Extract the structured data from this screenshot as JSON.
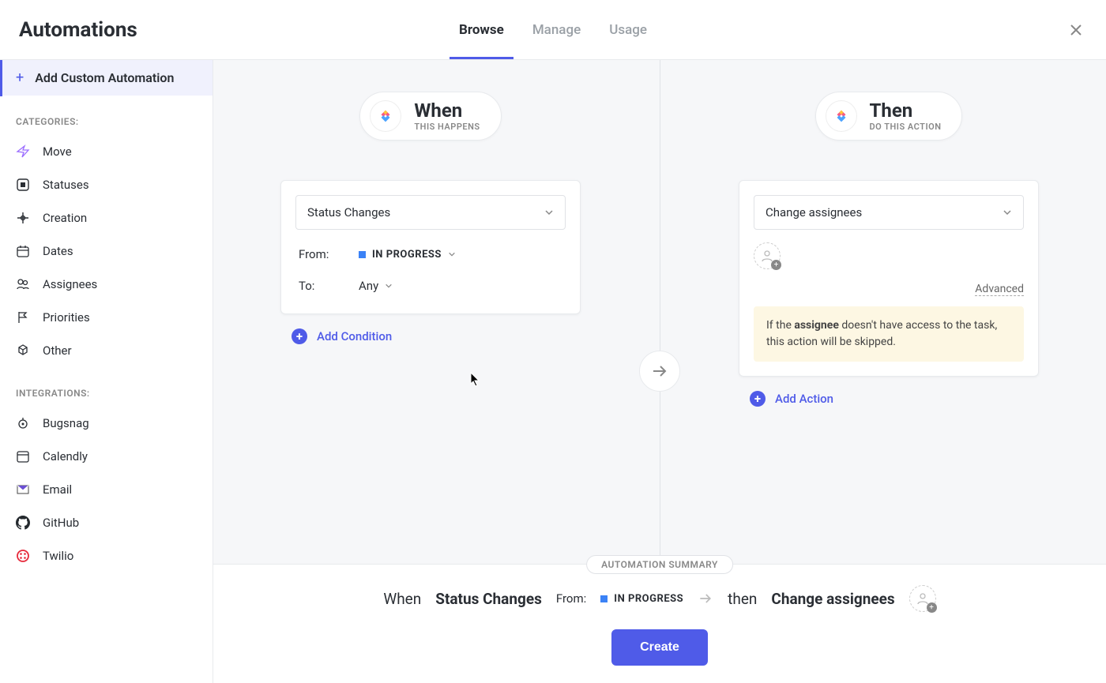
{
  "header": {
    "title": "Automations",
    "tabs": [
      "Browse",
      "Manage",
      "Usage"
    ],
    "active_tab": 0
  },
  "sidebar": {
    "add_button": "Add Custom Automation",
    "categories_label": "CATEGORIES:",
    "categories": [
      {
        "label": "Move",
        "icon": "move-icon"
      },
      {
        "label": "Statuses",
        "icon": "statuses-icon"
      },
      {
        "label": "Creation",
        "icon": "creation-icon"
      },
      {
        "label": "Dates",
        "icon": "dates-icon"
      },
      {
        "label": "Assignees",
        "icon": "assignees-icon"
      },
      {
        "label": "Priorities",
        "icon": "priorities-icon"
      },
      {
        "label": "Other",
        "icon": "other-icon"
      }
    ],
    "integrations_label": "INTEGRATIONS:",
    "integrations": [
      {
        "label": "Bugsnag",
        "icon": "bugsnag-icon"
      },
      {
        "label": "Calendly",
        "icon": "calendly-icon"
      },
      {
        "label": "Email",
        "icon": "email-icon"
      },
      {
        "label": "GitHub",
        "icon": "github-icon"
      },
      {
        "label": "Twilio",
        "icon": "twilio-icon"
      }
    ]
  },
  "when": {
    "title": "When",
    "subtitle": "THIS HAPPENS",
    "trigger": "Status Changes",
    "from_label": "From:",
    "from_value": "IN PROGRESS",
    "to_label": "To:",
    "to_value": "Any",
    "add_condition": "Add Condition"
  },
  "then": {
    "title": "Then",
    "subtitle": "DO THIS ACTION",
    "action": "Change assignees",
    "advanced": "Advanced",
    "notice_pre": "If the ",
    "notice_bold": "assignee",
    "notice_post": " doesn't have access to the task, this action will be skipped.",
    "add_action": "Add Action"
  },
  "summary": {
    "label": "AUTOMATION SUMMARY",
    "when_text": "When",
    "trigger": "Status Changes",
    "from_label": "From:",
    "from_value": "IN PROGRESS",
    "then_text": "then",
    "action": "Change assignees",
    "create": "Create"
  }
}
